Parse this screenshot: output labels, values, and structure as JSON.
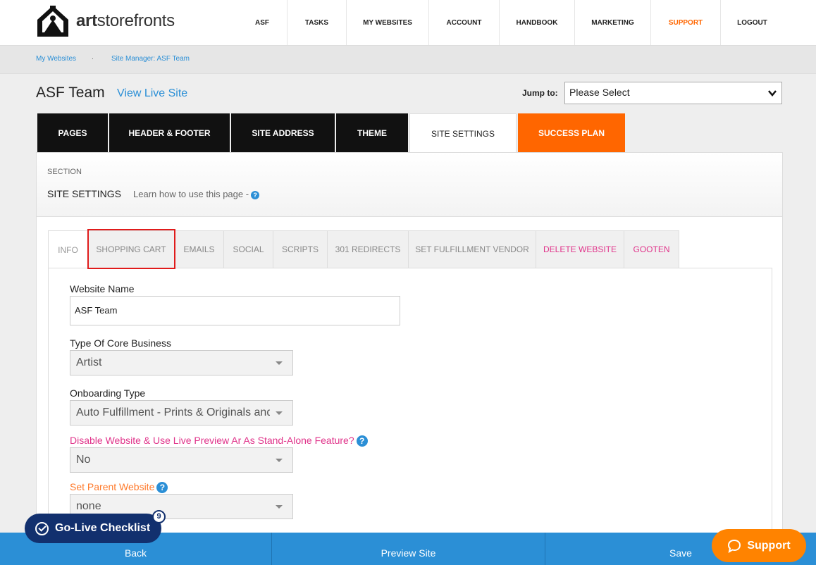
{
  "brand": {
    "name_bold": "art",
    "name_rest": "storefronts"
  },
  "nav": {
    "items": [
      {
        "label": "ASF",
        "width": 70
      },
      {
        "label": "TASKS",
        "width": 84
      },
      {
        "label": "MY WEBSITES",
        "width": 117
      },
      {
        "label": "ACCOUNT",
        "width": 100
      },
      {
        "label": "HANDBOOK",
        "width": 107
      },
      {
        "label": "MARKETING",
        "width": 108
      },
      {
        "label": "SUPPORT",
        "width": 99
      },
      {
        "label": "LOGOUT",
        "width": 90
      }
    ]
  },
  "breadcrumb": {
    "item1": "My Websites",
    "separator": ".",
    "item2": "Site Manager: ASF Team"
  },
  "header": {
    "title": "ASF Team",
    "view_live": "View Live Site",
    "jump_label": "Jump to:",
    "jump_value": "Please Select"
  },
  "main_tabs": [
    "PAGES",
    "HEADER & FOOTER",
    "SITE ADDRESS",
    "THEME",
    "SITE SETTINGS",
    "SUCCESS PLAN"
  ],
  "section": {
    "label": "SECTION",
    "title": "SITE SETTINGS",
    "learn": "Learn how to use this page -",
    "help_glyph": "?"
  },
  "sub_tabs": [
    "INFO",
    "SHOPPING CART",
    "EMAILS",
    "SOCIAL",
    "SCRIPTS",
    "301 REDIRECTS",
    "SET FULFILLMENT VENDOR",
    "DELETE WEBSITE",
    "GOOTEN"
  ],
  "form": {
    "website_name_label": "Website Name",
    "website_name_value": "ASF Team",
    "core_business_label": "Type Of Core Business",
    "core_business_value": "Artist",
    "onboarding_label": "Onboarding Type",
    "onboarding_value": "Auto Fulfillment - Prints & Originals and/",
    "disable_label": "Disable Website & Use Live Preview Ar As Stand-Alone Feature?",
    "disable_value": "No",
    "parent_label": "Set Parent Website",
    "parent_value": "none"
  },
  "bottom": {
    "back": "Back",
    "preview": "Preview Site",
    "save": "Save"
  },
  "golive": {
    "label": "Go-Live Checklist",
    "count": "9"
  },
  "support": {
    "label": "Support"
  },
  "colors": {
    "accent": "#2b8fd6",
    "orange": "#ff6600",
    "pink": "#e0338a",
    "navy": "#12306e"
  }
}
